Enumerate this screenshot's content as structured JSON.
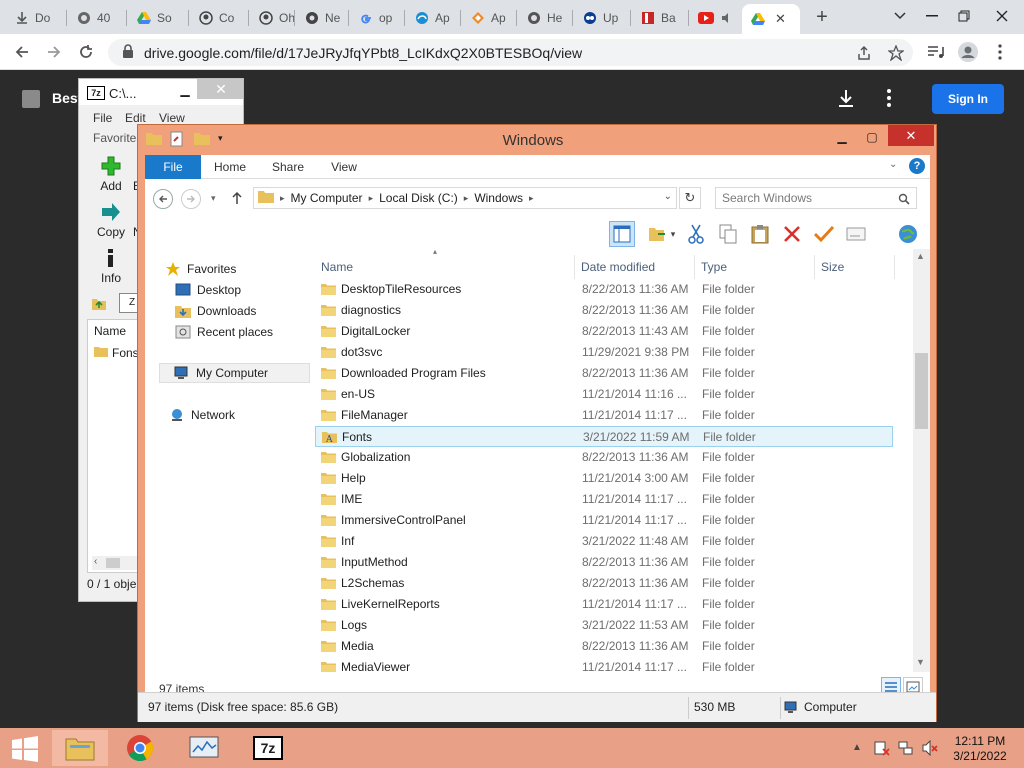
{
  "browser": {
    "tabs": [
      {
        "label": "Do",
        "icon": "download-icon"
      },
      {
        "label": "40",
        "icon": "globe-icon"
      },
      {
        "label": "So",
        "icon": "drive-icon"
      },
      {
        "label": "Co",
        "icon": "github-icon"
      },
      {
        "label": "Oh",
        "icon": "github-icon"
      },
      {
        "label": "Ne",
        "icon": "globe-icon"
      },
      {
        "label": "op",
        "icon": "google-icon"
      },
      {
        "label": "Ap",
        "icon": "edge-icon"
      },
      {
        "label": "Ap",
        "icon": "diamond-icon"
      },
      {
        "label": "He",
        "icon": "globe-icon"
      },
      {
        "label": "Up",
        "icon": "onedrive-icon"
      },
      {
        "label": "Ba",
        "icon": "banner-icon"
      }
    ],
    "url": "drive.google.com/file/d/17JeJRyJfqYPbt8_LcIKdxQ2X0BTESBOq/view"
  },
  "drive_viewer": {
    "doc_title": "Best",
    "signin_label": "Sign In"
  },
  "sevenzip": {
    "title": "C:\\...",
    "logo": "7z",
    "menu": [
      "File",
      "Edit",
      "View"
    ],
    "favorites": "Favorites",
    "tools": [
      {
        "label": "Add"
      },
      {
        "label": "Copy"
      },
      {
        "label": "Info"
      }
    ],
    "tools_cut": [
      "E",
      "N"
    ],
    "list_header": "Name",
    "list_item": "Fons",
    "status": "0 / 1 obje"
  },
  "explorer": {
    "title": "Windows",
    "ribbon_tabs": [
      "File",
      "Home",
      "Share",
      "View"
    ],
    "breadcrumb": [
      "My Computer",
      "Local Disk (C:)",
      "Windows"
    ],
    "search_placeholder": "Search Windows",
    "nav": {
      "favorites": "Favorites",
      "desktop": "Desktop",
      "downloads": "Downloads",
      "recent": "Recent places",
      "computer": "My Computer",
      "network": "Network"
    },
    "columns": {
      "name": "Name",
      "date": "Date modified",
      "type": "Type",
      "size": "Size"
    },
    "rows": [
      {
        "name": "DesktopTileResources",
        "date": "8/22/2013 11:36 AM",
        "type": "File folder"
      },
      {
        "name": "diagnostics",
        "date": "8/22/2013 11:36 AM",
        "type": "File folder"
      },
      {
        "name": "DigitalLocker",
        "date": "8/22/2013 11:43 AM",
        "type": "File folder"
      },
      {
        "name": "dot3svc",
        "date": "11/29/2021 9:38 PM",
        "type": "File folder"
      },
      {
        "name": "Downloaded Program Files",
        "date": "8/22/2013 11:36 AM",
        "type": "File folder"
      },
      {
        "name": "en-US",
        "date": "11/21/2014 11:16 ...",
        "type": "File folder"
      },
      {
        "name": "FileManager",
        "date": "11/21/2014 11:17 ...",
        "type": "File folder"
      },
      {
        "name": "Fonts",
        "date": "3/21/2022 11:59 AM",
        "type": "File folder",
        "selected": true
      },
      {
        "name": "Globalization",
        "date": "8/22/2013 11:36 AM",
        "type": "File folder"
      },
      {
        "name": "Help",
        "date": "11/21/2014 3:00 AM",
        "type": "File folder"
      },
      {
        "name": "IME",
        "date": "11/21/2014 11:17 ...",
        "type": "File folder"
      },
      {
        "name": "ImmersiveControlPanel",
        "date": "11/21/2014 11:17 ...",
        "type": "File folder"
      },
      {
        "name": "Inf",
        "date": "3/21/2022 11:48 AM",
        "type": "File folder"
      },
      {
        "name": "InputMethod",
        "date": "8/22/2013 11:36 AM",
        "type": "File folder"
      },
      {
        "name": "L2Schemas",
        "date": "8/22/2013 11:36 AM",
        "type": "File folder"
      },
      {
        "name": "LiveKernelReports",
        "date": "11/21/2014 11:17 ...",
        "type": "File folder"
      },
      {
        "name": "Logs",
        "date": "3/21/2022 11:53 AM",
        "type": "File folder"
      },
      {
        "name": "Media",
        "date": "8/22/2013 11:36 AM",
        "type": "File folder"
      },
      {
        "name": "MediaViewer",
        "date": "11/21/2014 11:17 ...",
        "type": "File folder"
      }
    ],
    "item_count": "97 items",
    "status": {
      "left": "97 items (Disk free space: 85.6 GB)",
      "size": "530 MB",
      "location": "Computer"
    }
  },
  "taskbar": {
    "time": "12:11 PM",
    "date": "3/21/2022",
    "sevenzip_label": "7z"
  },
  "colors": {
    "explorer_frame": "#f0a07a",
    "ribbon_file": "#1979ca",
    "close_red": "#c7312b",
    "taskbar": "#e8a087",
    "signin_blue": "#1a73e8",
    "selection": "#e5f3fb"
  }
}
